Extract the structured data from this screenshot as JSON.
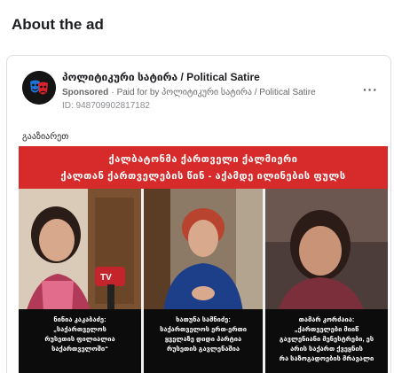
{
  "page_title": "About the ad",
  "ad": {
    "page_name": "პოლიტიკური სატირა / Political Satire",
    "sponsored_label": "Sponsored",
    "separator": "·",
    "paid_for_by": "Paid for by პოლიტიკური სატირა / Political Satire",
    "ad_id": "ID: 948709902817182",
    "more_icon": "···",
    "caption": "გააზიარეთ"
  },
  "image": {
    "banner_line_1": "ქალბატონმა ქართველი ქალმიერი",
    "banner_line_2": "ქალთან ქართველების წინ - აქამდე ილინების ფულს",
    "panels": [
      {
        "caption_lines": [
          "ნინია კაკაბაძე:",
          "„საქართველოს",
          "რუსეთის ფილიალია",
          "საქართველოში“"
        ]
      },
      {
        "caption_lines": [
          "ხათუნა სამნიძე:",
          "საქართველოს ერთ-ერთი",
          "ყველაზე დიდი პარტია",
          "რუსეთის გავლენაშია"
        ]
      },
      {
        "caption_lines": [
          "თამარ კორძაია:",
          "„ქართველები მიიწ",
          "გავლენიანი მენესტრები, ეს",
          "არის საქართ ქვეყნის",
          "რა საზოგადოების მრავალი"
        ]
      }
    ]
  },
  "colors": {
    "banner_red": "#d62b2a",
    "caption_black": "#0c0c0c"
  }
}
